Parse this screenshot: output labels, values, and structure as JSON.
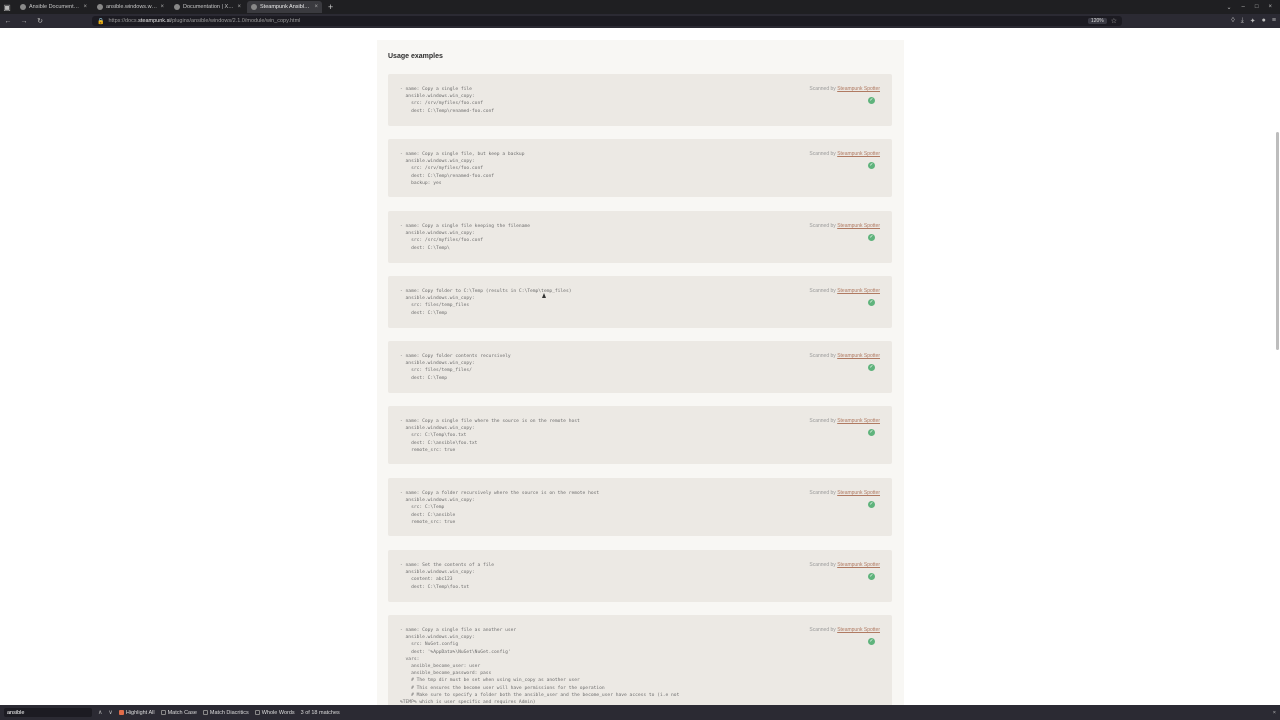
{
  "browser": {
    "tabs": [
      {
        "label": "Ansible Documentation",
        "active": false
      },
      {
        "label": "ansible.windows.win_co",
        "active": false
      },
      {
        "label": "Documentation | XLAB",
        "active": false
      },
      {
        "label": "Steampunk Ansible Doc",
        "active": true
      }
    ],
    "url_prefix": "https://docs.",
    "url_host": "steampunk.si",
    "url_path": "/plugins/ansible/windows/2.1.0/module/win_copy.html",
    "zoom": "120%"
  },
  "page": {
    "section_title": "Usage examples",
    "scanned_prefix": "Scanned by",
    "scanned_link": "Steampunk Spotter",
    "examples": [
      {
        "code": "- name: Copy a single file\n  ansible.windows.win_copy:\n    src: /srv/myfiles/foo.conf\n    dest: C:\\Temp\\renamed-foo.conf"
      },
      {
        "code": "- name: Copy a single file, but keep a backup\n  ansible.windows.win_copy:\n    src: /srv/myfiles/foo.conf\n    dest: C:\\Temp\\renamed-foo.conf\n    backup: yes"
      },
      {
        "code": "- name: Copy a single file keeping the filename\n  ansible.windows.win_copy:\n    src: /src/myfiles/foo.conf\n    dest: C:\\Temp\\"
      },
      {
        "code": "- name: Copy folder to C:\\Temp (results in C:\\Temp\\temp_files)\n  ansible.windows.win_copy:\n    src: files/temp_files\n    dest: C:\\Temp"
      },
      {
        "code": "- name: Copy folder contents recursively\n  ansible.windows.win_copy:\n    src: files/temp_files/\n    dest: C:\\Temp"
      },
      {
        "code": "- name: Copy a single file where the source is on the remote host\n  ansible.windows.win_copy:\n    src: C:\\Temp\\foo.txt\n    dest: C:\\ansible\\foo.txt\n    remote_src: true"
      },
      {
        "code": "- name: Copy a folder recursively where the source is on the remote host\n  ansible.windows.win_copy:\n    src: C:\\Temp\n    dest: C:\\ansible\n    remote_src: true"
      },
      {
        "code": "- name: Set the contents of a file\n  ansible.windows.win_copy:\n    content: abc123\n    dest: C:\\Temp\\foo.txt"
      },
      {
        "code": "- name: Copy a single file as another user\n  ansible.windows.win_copy:\n    src: NuGet.config\n    dest: '%AppData%\\NuGet\\NuGet.config'\n  vars:\n    ansible_become_user: user\n    ansible_become_password: pass\n    # The tmp dir must be set when using win_copy as another user\n    # This ensures the become user will have permissions for the operation\n    # Make sure to specify a folder both the ansible_user and the become_user have access to (i.e not\n%TEMP% which is user specific and requires Admin)"
      }
    ]
  },
  "findbar": {
    "query": "ansible",
    "highlight_all": "Highlight All",
    "match_case": "Match Case",
    "match_diacritics": "Match Diacritics",
    "whole_words": "Whole Words",
    "result": "3 of 18 matches"
  }
}
